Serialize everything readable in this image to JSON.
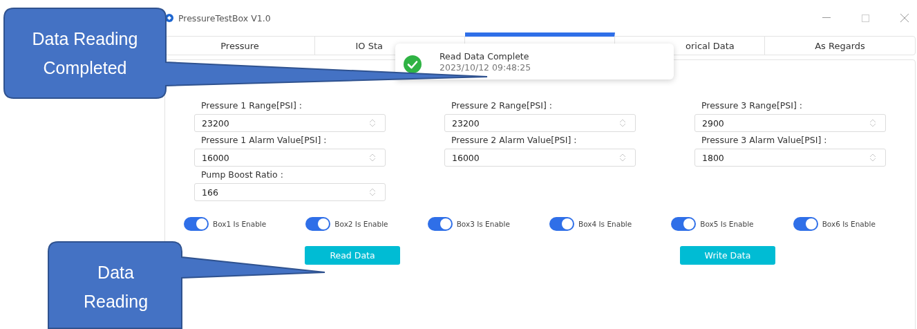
{
  "window": {
    "title": "PressureTestBox V1.0"
  },
  "tabs": [
    {
      "label": "Pressure",
      "selected": false
    },
    {
      "label": "IO Sta",
      "selected": false
    },
    {
      "selected": true
    },
    {
      "label": "orical Data",
      "selected": false
    },
    {
      "label": "As Regards",
      "selected": false
    }
  ],
  "toast": {
    "title": "Read Data Complete",
    "time": "2023/10/12 09:48:25"
  },
  "fields": [
    {
      "label": "Pressure 1 Range[PSI] :",
      "value": "23200"
    },
    {
      "label": "Pressure 2 Range[PSI] :",
      "value": "23200"
    },
    {
      "label": "Pressure 3 Range[PSI] :",
      "value": "2900"
    },
    {
      "label": "Pressure 1 Alarm Value[PSI] :",
      "value": "16000"
    },
    {
      "label": "Pressure 2 Alarm Value[PSI] :",
      "value": "16000"
    },
    {
      "label": "Pressure 3 Alarm Value[PSI] :",
      "value": "1800"
    },
    {
      "label": "Pump Boost Ratio :",
      "value": "166"
    }
  ],
  "boxes": [
    {
      "label": "Box1 Is Enable",
      "on": true
    },
    {
      "label": "Box2 Is Enable",
      "on": true
    },
    {
      "label": "Box3 Is Enable",
      "on": true
    },
    {
      "label": "Box4 Is Enable",
      "on": true
    },
    {
      "label": "Box5 Is Enable",
      "on": true
    },
    {
      "label": "Box6 Is Enable",
      "on": true
    }
  ],
  "buttons": [
    "Read Data",
    "Write Data"
  ],
  "callouts": [
    {
      "text": "Data Reading Completed"
    },
    {
      "text": "Data Reading"
    }
  ]
}
